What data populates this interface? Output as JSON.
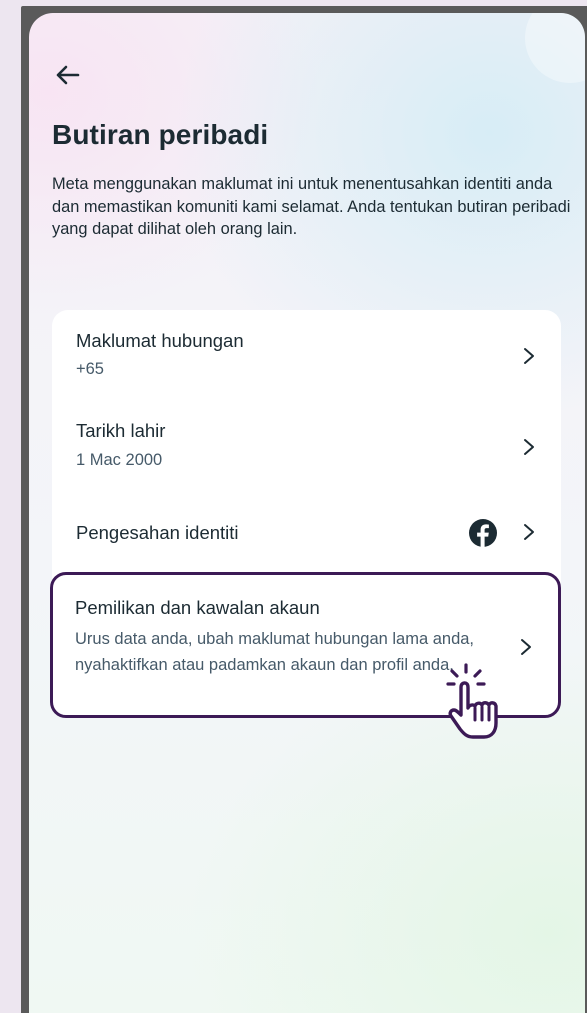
{
  "header": {
    "back_icon": "arrow-left-icon",
    "title": "Butiran peribadi",
    "description": "Meta menggunakan maklumat ini untuk menentusahkan identiti anda dan memastikan komuniti kami selamat. Anda tentukan butiran peribadi yang dapat dilihat oleh orang lain."
  },
  "items": [
    {
      "title": "Maklumat hubungan",
      "subtitle": "+65"
    },
    {
      "title": "Tarikh lahir",
      "subtitle": "1 Mac 2000"
    },
    {
      "title": "Pengesahan identiti",
      "icon": "facebook-icon"
    },
    {
      "title": "Pemilikan dan kawalan akaun",
      "subtitle": "Urus data anda, ubah maklumat hubungan lama anda, nyahaktifkan atau padamkan akaun dan profil anda."
    }
  ],
  "colors": {
    "text": "#1c2b33",
    "secondary_text": "#465a69",
    "highlight_border": "#3c1a56",
    "facebook_icon": "#1c2b33"
  }
}
